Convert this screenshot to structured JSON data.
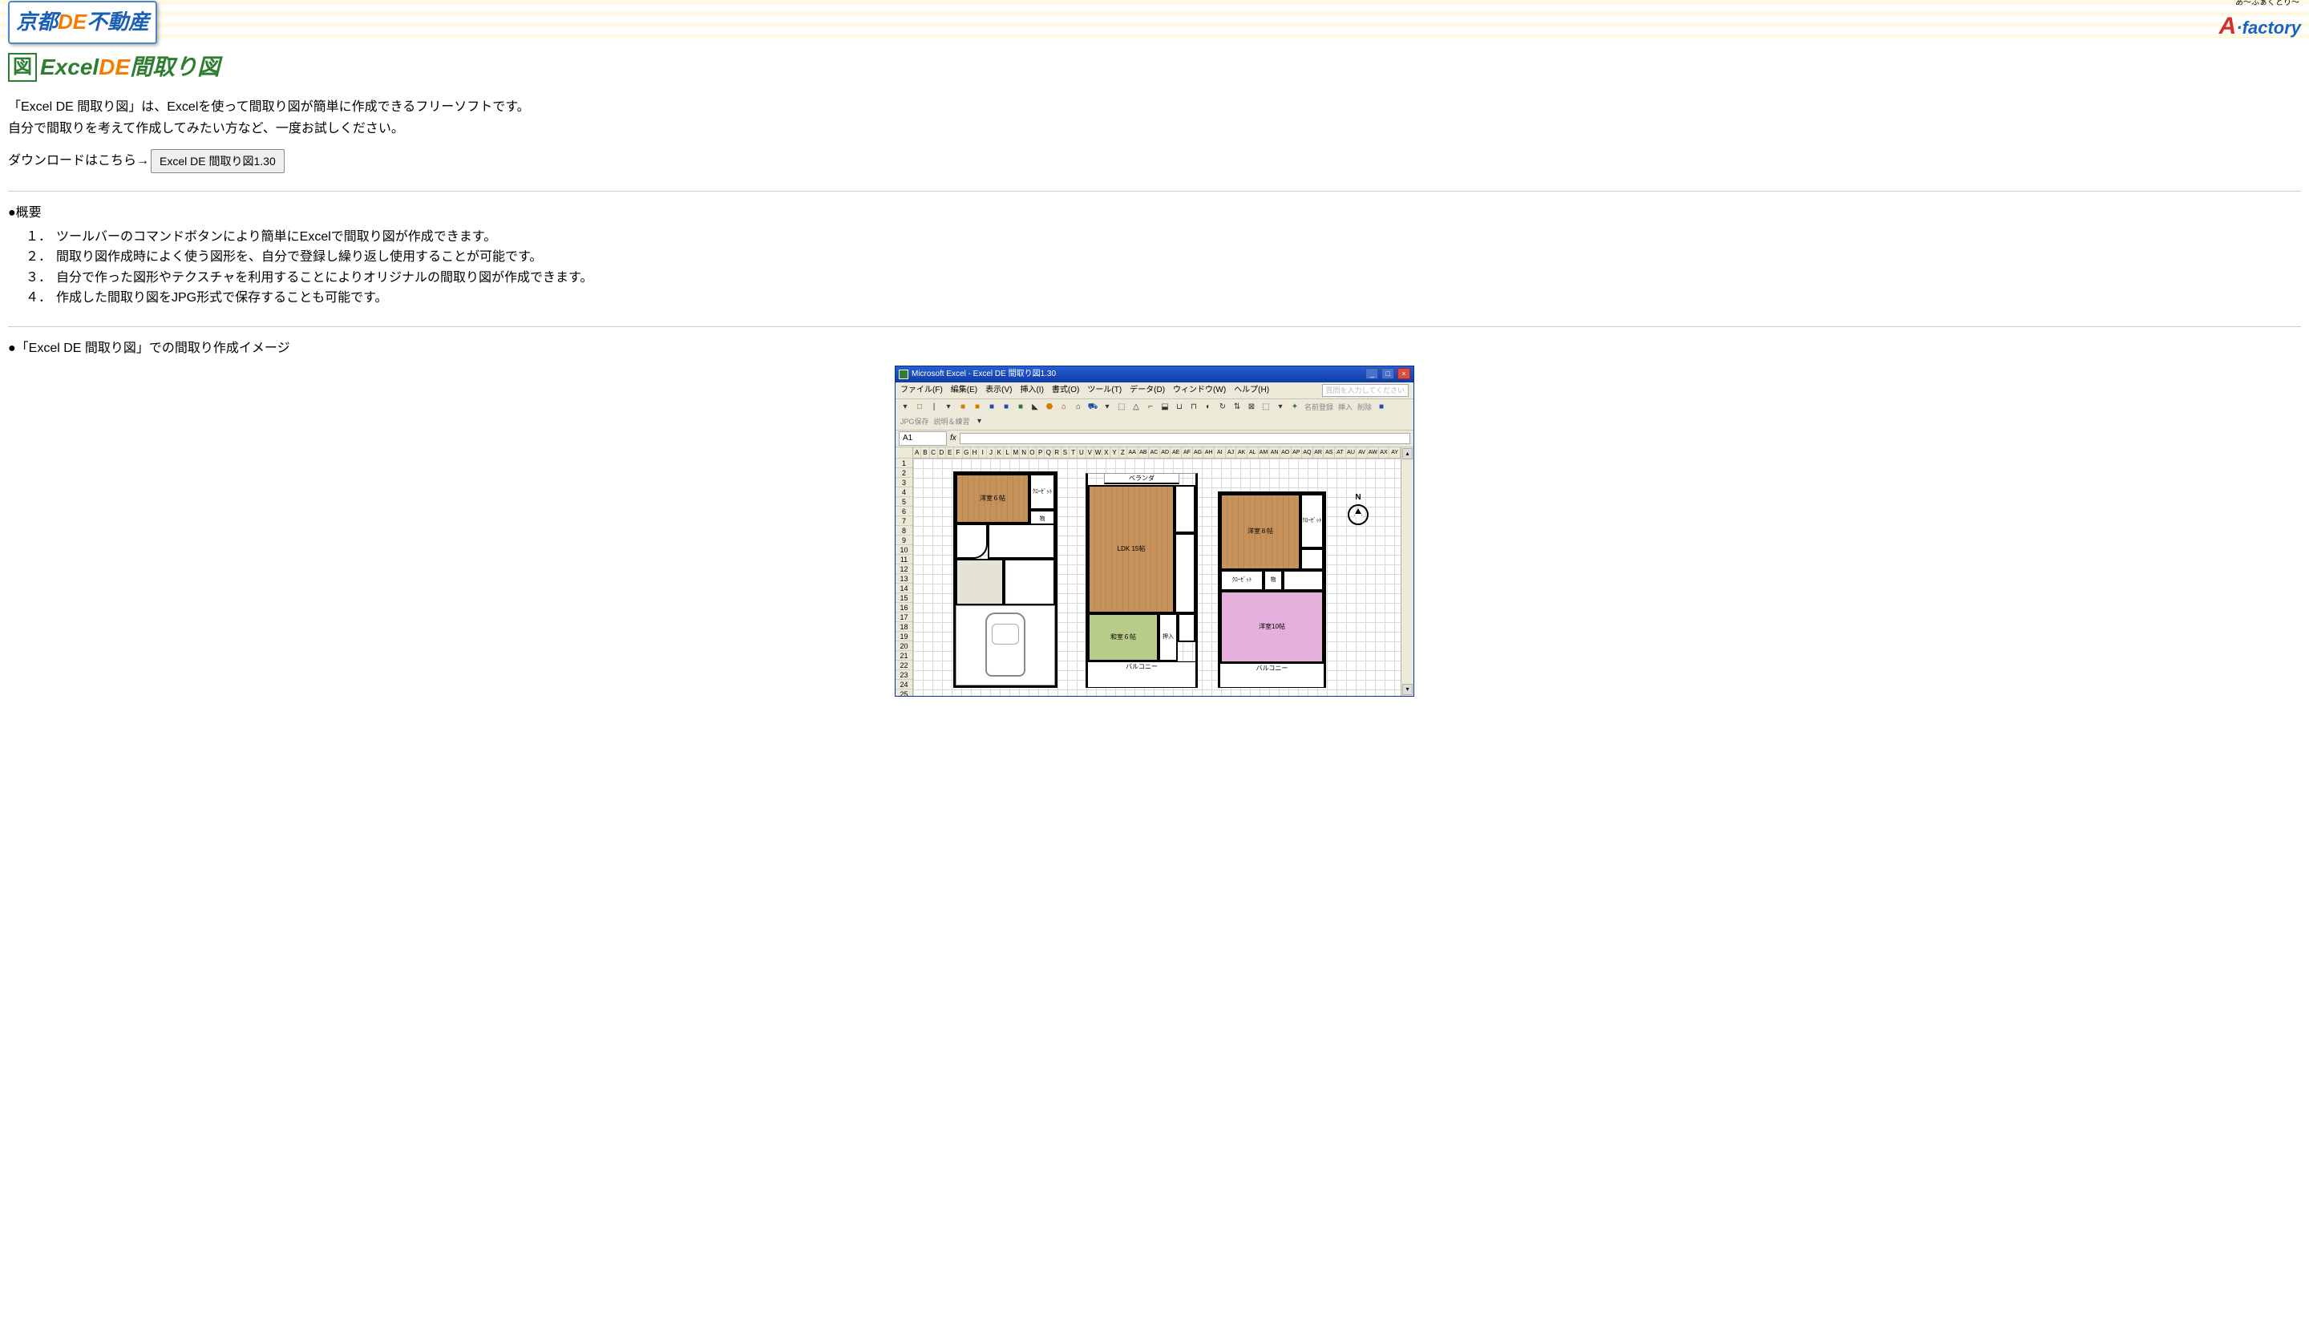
{
  "header": {
    "logo_left_blue1": "京都",
    "logo_left_orange": "DE",
    "logo_left_blue2": "不動産",
    "logo_right_ruby": "あ～ふぁくとり～",
    "logo_right_a": "A",
    "logo_right_dot": "·",
    "logo_right_factory": "factory"
  },
  "title": {
    "icon_text": "図",
    "green1": "Excel",
    "orange": "DE",
    "green2": "間取り図"
  },
  "intro": {
    "line1": "「Excel DE 間取り図」は、Excelを使って間取り図が簡単に作成できるフリーソフトです。",
    "line2": "自分で間取りを考えて作成してみたい方など、一度お試しください。",
    "download_label": "ダウンロードはこちら→",
    "download_button": "Excel DE 間取り図1.30"
  },
  "overview": {
    "heading": "●概要",
    "items": [
      {
        "num": "１．",
        "text": "ツールバーのコマンドボタンにより簡単にExcelで間取り図が作成できます。"
      },
      {
        "num": "２．",
        "text": "間取り図作成時によく使う図形を、自分で登録し繰り返し使用することが可能です。"
      },
      {
        "num": "３．",
        "text": "自分で作った図形やテクスチャを利用することによりオリジナルの間取り図が作成できます。"
      },
      {
        "num": "４．",
        "text": "作成した間取り図をJPG形式で保存することも可能です。"
      }
    ]
  },
  "image_section": {
    "heading": "●「Excel DE 間取り図」での間取り作成イメージ"
  },
  "excel": {
    "title": "Microsoft Excel - Excel DE 間取り図1.30",
    "menu": [
      "ファイル(F)",
      "編集(E)",
      "表示(V)",
      "挿入(I)",
      "書式(O)",
      "ツール(T)",
      "データ(D)",
      "ウィンドウ(W)",
      "ヘルプ(H)"
    ],
    "help_placeholder": "質問を入力してください",
    "toolbar_labels": {
      "name_reg": "名前登録",
      "insert": "挿入",
      "delete": "削除",
      "jpg": "JPG保存",
      "manual": "説明＆練習"
    },
    "namebox": "A1",
    "cols": [
      "A",
      "B",
      "C",
      "D",
      "E",
      "F",
      "G",
      "H",
      "I",
      "J",
      "K",
      "L",
      "M",
      "N",
      "O",
      "P",
      "Q",
      "R",
      "S",
      "T",
      "U",
      "V",
      "W",
      "X",
      "Y",
      "Z",
      "AA",
      "AB",
      "AC",
      "AD",
      "AE",
      "AF",
      "AG",
      "AH",
      "AI",
      "AJ",
      "AK",
      "AL",
      "AM",
      "AN",
      "AO",
      "AP",
      "AQ",
      "AR",
      "AS",
      "AT",
      "AU",
      "AV",
      "AW",
      "AX",
      "AY"
    ],
    "rows": [
      "1",
      "2",
      "3",
      "4",
      "5",
      "6",
      "7",
      "8",
      "9",
      "10",
      "11",
      "12",
      "13",
      "14",
      "15",
      "16",
      "17",
      "18",
      "19",
      "20",
      "21",
      "22",
      "23",
      "24",
      "25"
    ],
    "compass_n": "N",
    "rooms": {
      "yoshitsu6": "洋室６帖",
      "closet": "ｸﾛｰｾﾞｯﾄ",
      "mono": "物",
      "veranda": "ベランダ",
      "ldk": "LDK 15帖",
      "washitsu6": "和室６帖",
      "oshiire": "押入",
      "yoshitsu8": "洋室８帖",
      "yoshitsu10": "洋室10帖",
      "balcony": "バルコニー"
    }
  }
}
